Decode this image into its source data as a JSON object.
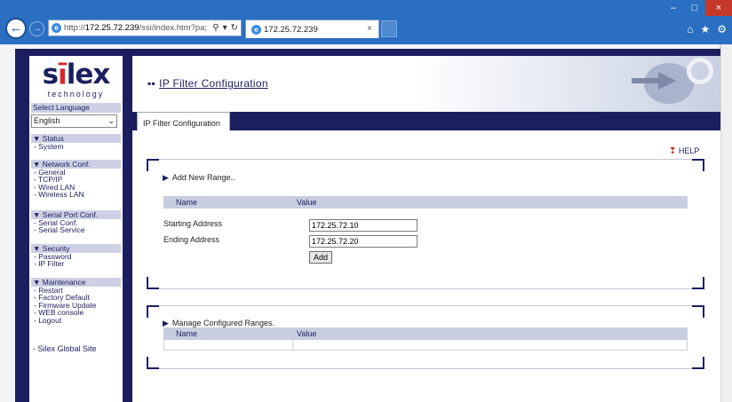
{
  "browser": {
    "url_prefix": "http://",
    "url_host": "172.25.72.239",
    "url_rest": "/ssi/index.htm?pa;",
    "tab_title": "172.25.72.239",
    "win_minimize": "–",
    "win_maximize": "□",
    "win_close": "×",
    "back": "←",
    "forward": "→",
    "search_icon": "⚲",
    "dropdown_icon": "▾",
    "refresh_icon": "↻",
    "tab_close": "×",
    "home_icon": "⌂",
    "favorites_icon": "★",
    "settings_icon": "⚙"
  },
  "logo": {
    "word_start": "s",
    "word_dot": "ī",
    "word_end": "lex",
    "sub": "technology"
  },
  "sidebar": {
    "select_language_label": "Select Language",
    "language_value": "English",
    "chevron": "⌄",
    "groups": [
      {
        "title": "▼ Status",
        "items": [
          "- System"
        ]
      },
      {
        "title": "▼ Network Conf.",
        "items": [
          "- General",
          "- TCP/IP",
          "- Wired LAN",
          "- Wireless LAN"
        ]
      },
      {
        "title": "▼ Serial Port Conf.",
        "items": [
          "- Serial Conf.",
          "- Serial Service"
        ]
      },
      {
        "title": "▼ Security",
        "items": [
          "- Password",
          "- IP Filter"
        ]
      },
      {
        "title": "▼ Maintenance",
        "items": [
          "- Restart",
          "- Factory Default",
          "- Firmware Update",
          "- WEB console",
          "- Logout"
        ]
      }
    ],
    "global_site": "- Silex Global Site"
  },
  "header": {
    "title_icon": "▪▪",
    "title": "IP Filter Configuration"
  },
  "tabs": {
    "active": "IP Filter Configuration"
  },
  "help": {
    "icon": "❢",
    "label": "HELP"
  },
  "add_range": {
    "title": "Add New Range..",
    "col_name": "Name",
    "col_value": "Value",
    "starting_label": "Starting Address",
    "starting_value": "172.25.72.10",
    "ending_label": "Ending Address",
    "ending_value": "172.25.72.20",
    "add_button": "Add"
  },
  "manage_ranges": {
    "title": "Manage Configured Ranges.",
    "col_name": "Name",
    "col_value": "Value"
  },
  "triangle": "▶"
}
